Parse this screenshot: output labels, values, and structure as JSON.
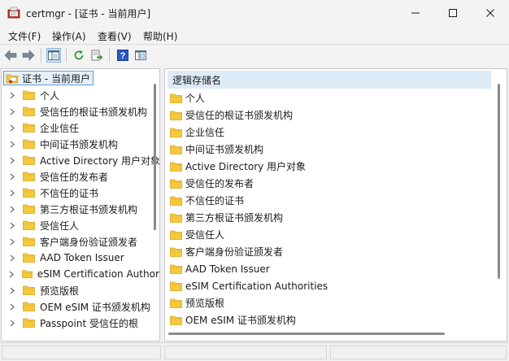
{
  "window": {
    "title": "certmgr - [证书 - 当前用户]",
    "controls": [
      "minimize",
      "maximize",
      "close"
    ]
  },
  "menu": [
    {
      "label": "文件(F)"
    },
    {
      "label": "操作(A)"
    },
    {
      "label": "查看(V)"
    },
    {
      "label": "帮助(H)"
    }
  ],
  "toolbar": {
    "icons": [
      "back-arrow-icon",
      "forward-arrow-icon",
      "show-hide-tree-icon",
      "refresh-icon",
      "export-list-icon",
      "help-icon",
      "properties-icon"
    ]
  },
  "tree": {
    "root_label": "证书 - 当前用户",
    "items": [
      {
        "label": "个人"
      },
      {
        "label": "受信任的根证书颁发机构"
      },
      {
        "label": "企业信任"
      },
      {
        "label": "中间证书颁发机构"
      },
      {
        "label": "Active Directory 用户对象"
      },
      {
        "label": "受信任的发布者"
      },
      {
        "label": "不信任的证书"
      },
      {
        "label": "第三方根证书颁发机构"
      },
      {
        "label": "受信任人"
      },
      {
        "label": "客户端身份验证颁发者"
      },
      {
        "label": "AAD Token Issuer"
      },
      {
        "label": "eSIM Certification Authorities"
      },
      {
        "label": "预览版根"
      },
      {
        "label": "OEM eSIM 证书颁发机构"
      },
      {
        "label": "Passpoint 受信任的根"
      }
    ]
  },
  "list": {
    "column_header": "逻辑存储名",
    "items": [
      {
        "label": "个人"
      },
      {
        "label": "受信任的根证书颁发机构"
      },
      {
        "label": "企业信任"
      },
      {
        "label": "中间证书颁发机构"
      },
      {
        "label": "Active Directory 用户对象"
      },
      {
        "label": "受信任的发布者"
      },
      {
        "label": "不信任的证书"
      },
      {
        "label": "第三方根证书颁发机构"
      },
      {
        "label": "受信任人"
      },
      {
        "label": "客户端身份验证颁发者"
      },
      {
        "label": "AAD Token Issuer"
      },
      {
        "label": "eSIM Certification Authorities"
      },
      {
        "label": "预览版根"
      },
      {
        "label": "OEM eSIM 证书颁发机构"
      }
    ]
  },
  "colors": {
    "folder": "#f5c93e",
    "folder_dark": "#d9a520",
    "chrome": "#f3f3f3",
    "header_bg": "#ddebf7",
    "selection": "#e5f0fb"
  }
}
